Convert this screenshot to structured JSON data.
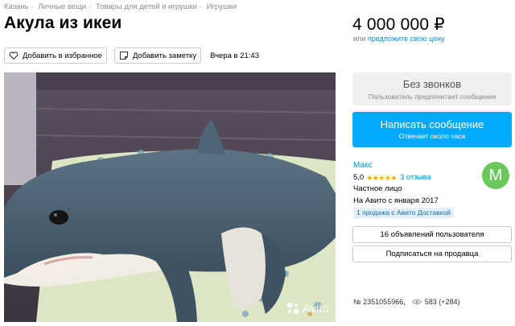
{
  "breadcrumbs": [
    "Казань",
    "Личные вещи",
    "Товары для детей и игрушки",
    "Игрушки"
  ],
  "listing": {
    "title": "Акула из икеи",
    "price": "4 000 000 ₽",
    "price_or": "или",
    "price_offer": "предложите свою цену",
    "favorite_label": "Добавить в избранное",
    "note_label": "Добавить заметку",
    "posted": "Вчера в 21:43"
  },
  "contact": {
    "no_calls_title": "Без звонков",
    "no_calls_sub": "Пользователь предпочитает сообщения",
    "message_title": "Написать сообщение",
    "message_sub": "Отвечает около часа"
  },
  "seller": {
    "name": "Макс",
    "rating": "5,0",
    "stars": "★★★★★",
    "reviews": "3 отзыва",
    "type": "Частное лицо",
    "since": "На Авито с января 2017",
    "badge": "1 продажа с Авито Доставкой",
    "avatar_letter": "М",
    "avatar_color": "#6bc95c"
  },
  "buttons": {
    "user_ads": "16 объявлений пользователя",
    "subscribe": "Подписаться на продавца"
  },
  "meta": {
    "ad_number": "№ 2351055966,",
    "views": "583 (+284)"
  },
  "photo": {
    "watermark": "Avito",
    "subject": "plush shark toy"
  },
  "colors": {
    "accent": "#00aaff",
    "link": "#0091d9",
    "star": "#ffa800"
  },
  "icons": [
    "heart-icon",
    "note-icon",
    "eye-icon",
    "avito-logo-icon"
  ]
}
